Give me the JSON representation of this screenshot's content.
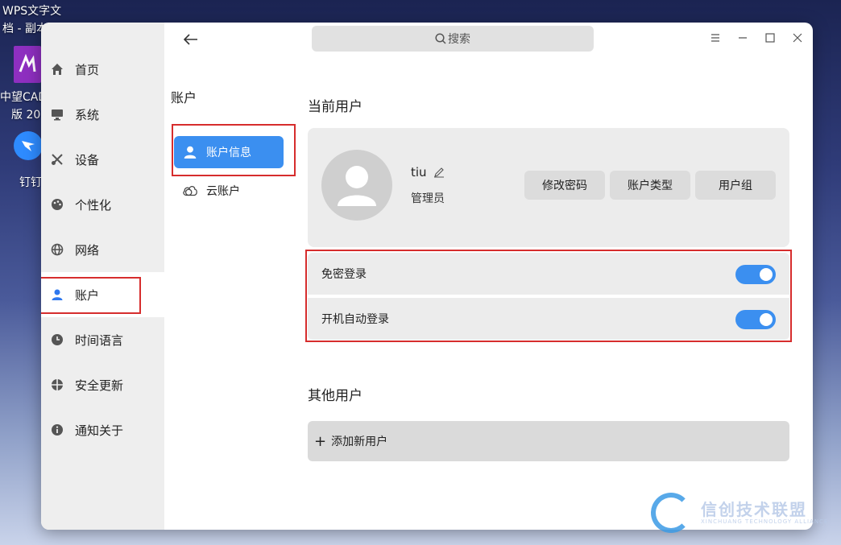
{
  "desktop": {
    "icons": [
      {
        "label_line1": "WPS文字文",
        "label_line2": "档 - 副本"
      },
      {
        "label_line1": "中望CAD",
        "label_line2": "版 20"
      },
      {
        "label_line1": "钉钉"
      }
    ]
  },
  "window": {
    "search_placeholder": "搜索",
    "controls": [
      "menu-icon",
      "minimize-icon",
      "maximize-icon",
      "close-icon"
    ]
  },
  "sidebar": {
    "items": [
      {
        "label": "首页",
        "icon": "home-icon"
      },
      {
        "label": "系统",
        "icon": "monitor-icon"
      },
      {
        "label": "设备",
        "icon": "tools-icon"
      },
      {
        "label": "个性化",
        "icon": "palette-icon"
      },
      {
        "label": "网络",
        "icon": "globe-icon"
      },
      {
        "label": "账户",
        "icon": "user-icon",
        "active": true
      },
      {
        "label": "时间语言",
        "icon": "clock-icon"
      },
      {
        "label": "安全更新",
        "icon": "shield-icon"
      },
      {
        "label": "通知关于",
        "icon": "info-icon"
      }
    ]
  },
  "subnav": {
    "title": "账户",
    "items": [
      {
        "label": "账户信息",
        "icon": "user-icon",
        "active": true
      },
      {
        "label": "云账户",
        "icon": "cloud-icon"
      }
    ]
  },
  "current_user": {
    "section_title": "当前用户",
    "username": "tiu",
    "role": "管理员",
    "buttons": [
      "修改密码",
      "账户类型",
      "用户组"
    ]
  },
  "settings": [
    {
      "label": "免密登录",
      "enabled": true
    },
    {
      "label": "开机自动登录",
      "enabled": true
    }
  ],
  "other_users": {
    "section_title": "其他用户",
    "add_label": "添加新用户"
  },
  "watermark": {
    "title": "信创技术联盟",
    "subtitle": "XINCHUANG TECHNOLOGY ALLIANCE"
  },
  "colors": {
    "accent": "#3b8ff0",
    "highlight_box": "#d62d2d"
  }
}
